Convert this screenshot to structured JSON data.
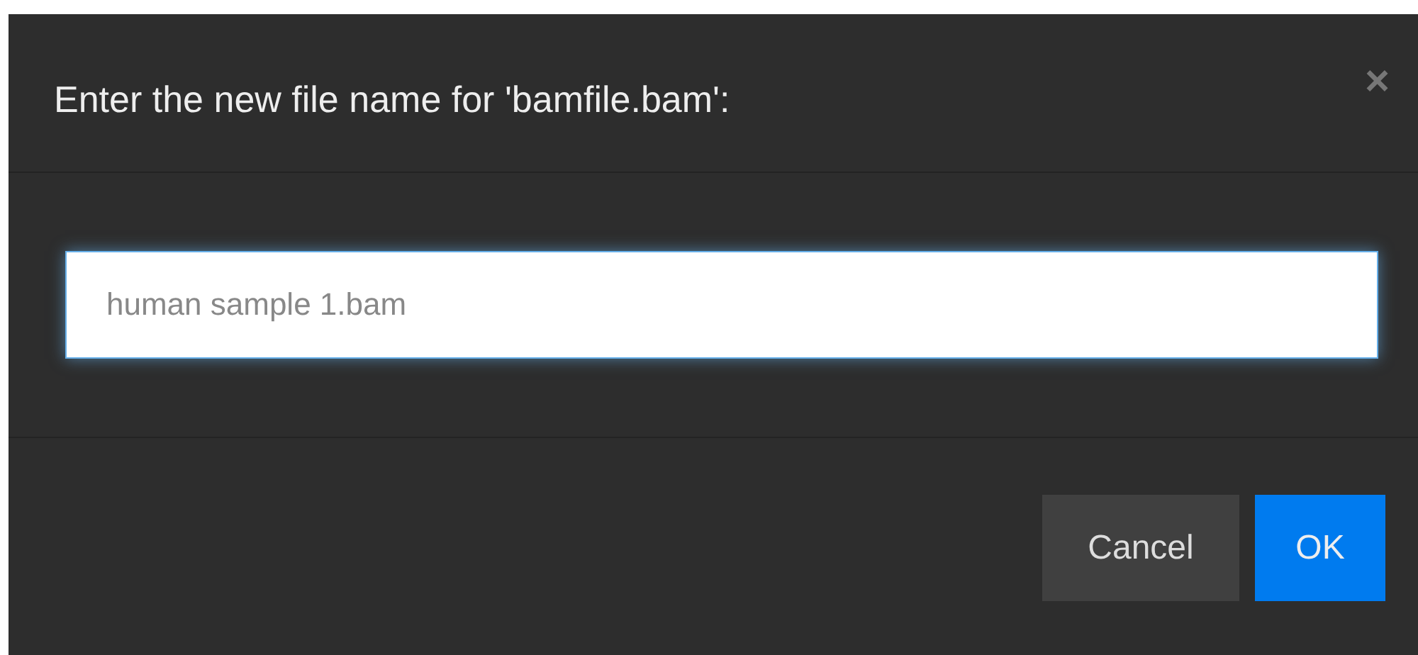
{
  "dialog": {
    "title": "Enter the new file name for 'bamfile.bam':",
    "close": "×"
  },
  "field": {
    "value": "human sample 1.bam"
  },
  "buttons": [
    {
      "label": "Cancel",
      "kind": "secondary"
    },
    {
      "label": "OK",
      "kind": "primary"
    }
  ]
}
